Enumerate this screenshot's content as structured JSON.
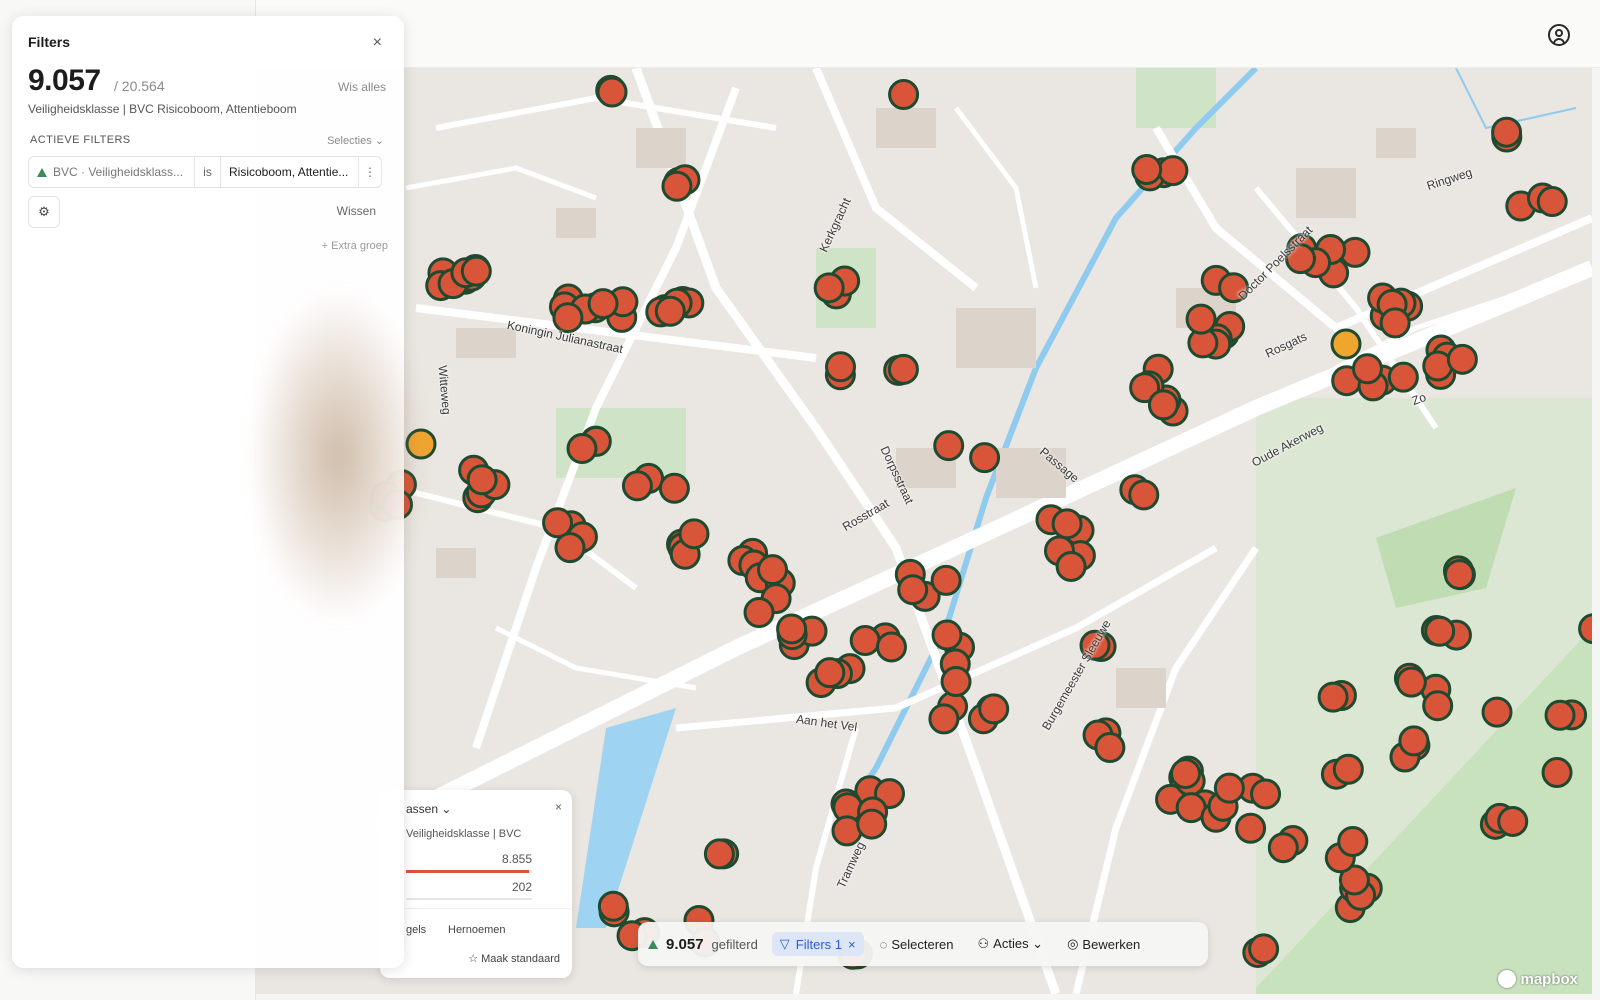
{
  "filters_panel": {
    "title": "Filters",
    "close": "×",
    "count": "9.057",
    "total": "/ 20.564",
    "clear_all": "Wis alles",
    "subtitle": "Veiligheidsklasse | BVC Risicoboom, Attentieboom",
    "active_heading": "ACTIEVE FILTERS",
    "selections": "Selecties ⌄",
    "filter": {
      "field": "BVC · Veiligheidsklass...",
      "operator": "is",
      "value": "Risicoboom, Attentie...",
      "more": "⋮"
    },
    "sliders_icon": "⚙",
    "clear": "Wissen",
    "extra_group": "+ Extra groep"
  },
  "legend": {
    "title": "assen ⌄",
    "close": "×",
    "subtitle": "Veiligheidsklasse | BVC",
    "value1": "8.855",
    "value2": "202",
    "action_a": "gels",
    "action_b": "Hernoemen",
    "action_c": "☆ Maak standaard",
    "fill_fraction": 0.98
  },
  "toolbar": {
    "count": "9.057",
    "filtered": "gefilterd",
    "filters": "Filters 1",
    "filters_close": "×",
    "select": "Selecteren",
    "actions": "Acties ⌄",
    "edit": "Bewerken"
  },
  "map": {
    "labels": [
      "Koningin Julianastraat",
      "Witteweg",
      "Kerkgracht",
      "Dorpsstraat",
      "Rosstraat",
      "Passage",
      "Rosgats",
      "Doctor Poelsstraat",
      "Ringweg",
      "Oude Akerweg",
      "Aan het Vel",
      "Burgemeester Sleeuwe",
      "Tramweg",
      "Zo"
    ],
    "attribution": "mapbox"
  },
  "colors": {
    "marker": "#d9553a",
    "marker_border": "#1f4a2f",
    "marker_alt": "#f0a52f",
    "accent": "#2d5fcf"
  }
}
